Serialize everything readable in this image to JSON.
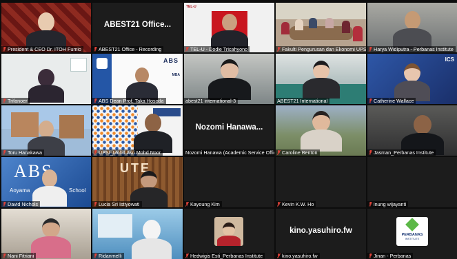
{
  "meeting": {
    "tiles": [
      {
        "name": "President & CEO Dr. ITOH Fumio"
      },
      {
        "name": "ABEST21 Office - Recording",
        "display_text": "ABEST21 Office..."
      },
      {
        "name": "TEL-U - Dodie Tricahyono",
        "logo_text": "TEL-U"
      },
      {
        "name": "Fakulti Pengurusan dan Ekonomi UPSI"
      },
      {
        "name": "Harya Widiputra - Perbanas Institute"
      },
      {
        "name": "Trifanoer"
      },
      {
        "name": "ABS Dean Prof. Taka Hosoda",
        "logo_text": "ABS",
        "logo_sub": "MBA"
      },
      {
        "name": "abest21 international-3"
      },
      {
        "name": "ABEST21 International"
      },
      {
        "name": "Catherine Wallace",
        "logo_text": "ICS"
      },
      {
        "name": "Toru Hanakawa"
      },
      {
        "name": "UPSI_Mohd Asri Mohd Noor"
      },
      {
        "name": "Nozomi Hanawa (Academic Service Offic...",
        "display_text": "Nozomi Hanawa..."
      },
      {
        "name": "Caroline Benton"
      },
      {
        "name": "Jasman_Perbanas Institute"
      },
      {
        "name": "David Nichols",
        "logo_text": "ABS",
        "logo_sub": "Aoyama",
        "logo_sub2": "School"
      },
      {
        "name": "Lucia Sri Istiyowati",
        "logo_text": "UTE"
      },
      {
        "name": "Kayoung Kim"
      },
      {
        "name": "Kevin K.W. Ho"
      },
      {
        "name": "inung wijayanti"
      },
      {
        "name": "Nani Fitriani"
      },
      {
        "name": "Ridanmelli"
      },
      {
        "name": "Hedwigis Esti_Perbanas Institute"
      },
      {
        "name": "kino.yasuhiro.fw",
        "display_text": "kino.yasuhiro.fw"
      },
      {
        "name": "Jinan - Perbanas",
        "logo_text": "PERBANAS",
        "logo_sub": "INSTITUTE"
      }
    ]
  },
  "colors": {
    "muted_mic": "#e0433a",
    "active_border": "#5fd39a",
    "tile_bg": "#232323"
  },
  "icons": {
    "mic": "mic-muted-icon"
  }
}
